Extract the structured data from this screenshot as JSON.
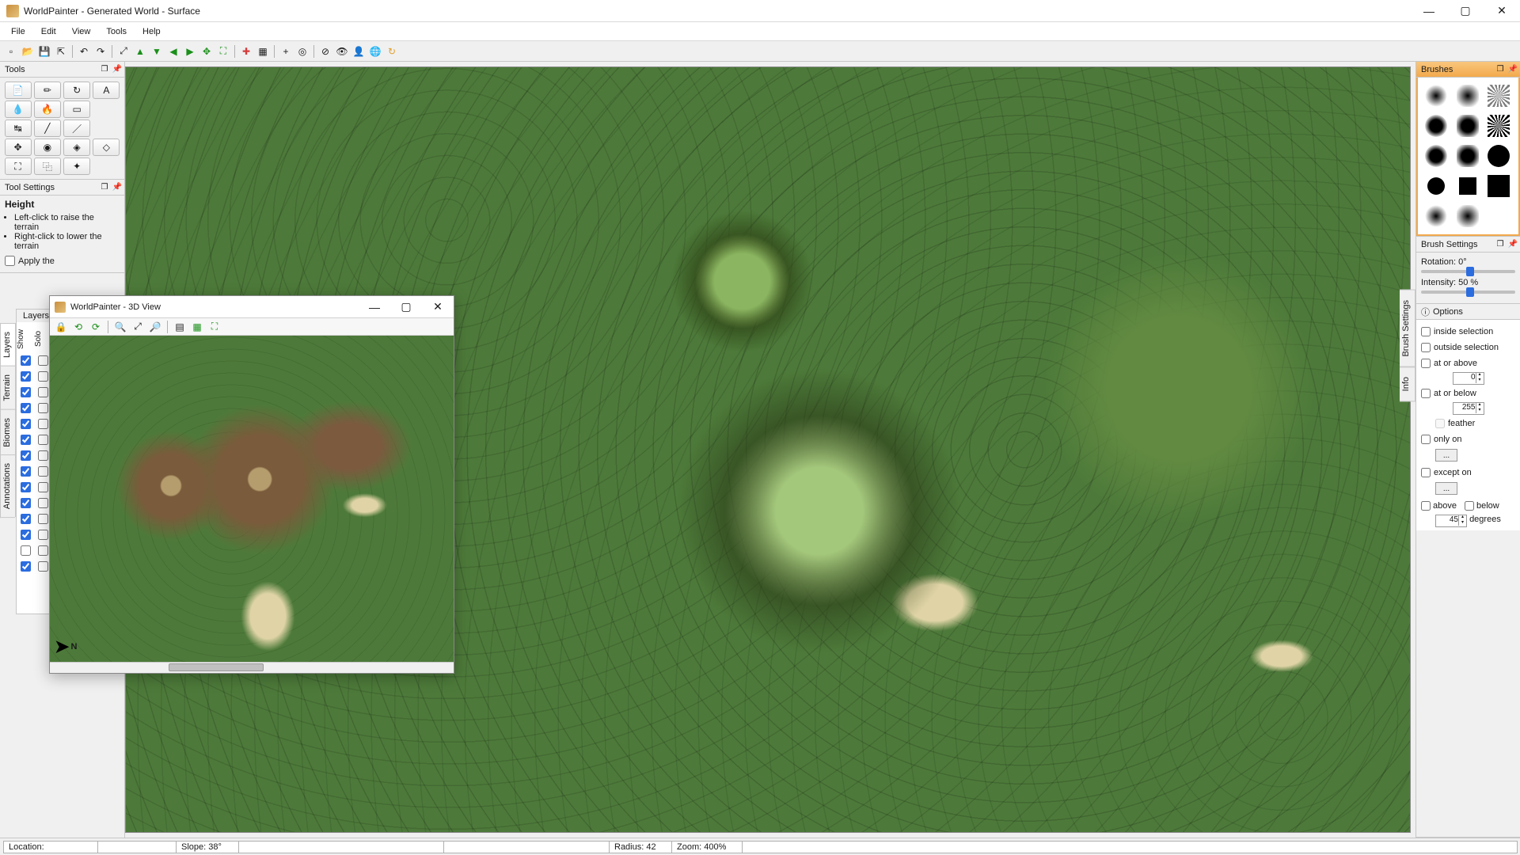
{
  "window": {
    "title": "WorldPainter - Generated World - Surface"
  },
  "menus": [
    "File",
    "Edit",
    "View",
    "Tools",
    "Help"
  ],
  "main_toolbar_icons": [
    "new",
    "open",
    "save",
    "export",
    "sep",
    "undo",
    "redo",
    "sep",
    "zoom-reset",
    "zoom-fit",
    "sep",
    "center-up",
    "center-down",
    "center-left",
    "center-right",
    "move-all",
    "sep",
    "marker",
    "grid",
    "sep",
    "plus",
    "circle-target",
    "sep",
    "eye-off",
    "eye",
    "world",
    "globe2",
    "refresh"
  ],
  "tools_panel": {
    "title": "Tools",
    "tools": [
      {
        "name": "import-tool",
        "glyph": "📄"
      },
      {
        "name": "pencil-tool",
        "glyph": "✏"
      },
      {
        "name": "rotate-tool",
        "glyph": "↻"
      },
      {
        "name": "text-tool",
        "glyph": "A"
      },
      {
        "name": "drop-tool",
        "glyph": "💧"
      },
      {
        "name": "flame-tool",
        "glyph": "🔥"
      },
      {
        "name": "rect-tool",
        "glyph": "▭"
      },
      {
        "name": "blank1",
        "glyph": ""
      },
      {
        "name": "swap-tool",
        "glyph": "↹"
      },
      {
        "name": "line-tool",
        "glyph": "╱"
      },
      {
        "name": "line2-tool",
        "glyph": "／"
      },
      {
        "name": "blank2",
        "glyph": ""
      },
      {
        "name": "move-tool",
        "glyph": "✥"
      },
      {
        "name": "sphere-tool",
        "glyph": "◉"
      },
      {
        "name": "eye-tool",
        "glyph": "◈"
      },
      {
        "name": "eye2-tool",
        "glyph": "◇"
      },
      {
        "name": "select-tool",
        "glyph": "⛶"
      },
      {
        "name": "copy-tool",
        "glyph": "⿻"
      },
      {
        "name": "sparkle-tool",
        "glyph": "✦"
      },
      {
        "name": "blank3",
        "glyph": ""
      }
    ]
  },
  "tool_settings": {
    "title": "Tool Settings",
    "heading": "Height",
    "bullets": [
      "Left-click to raise the terrain",
      "Right-click to lower the terrain"
    ],
    "apply_theme_label": "Apply the"
  },
  "side_tabs_left": [
    "Layers",
    "Terrain",
    "Biomes",
    "Annotations"
  ],
  "layers": {
    "title": "Layers",
    "col_headers": [
      "Show",
      "Solo"
    ],
    "rows": 14
  },
  "float_window": {
    "title": "WorldPainter - 3D View",
    "toolbar_icons": [
      "lock",
      "rotate-ccw",
      "rotate-cw",
      "sep",
      "zoom-out",
      "zoom-reset",
      "zoom-in",
      "sep",
      "layers",
      "grid",
      "expand"
    ],
    "compass": "N"
  },
  "right": {
    "brushes_title": "Brushes",
    "brush_settings_title": "Brush Settings",
    "rotation_label": "Rotation:",
    "rotation_value": "0°",
    "intensity_label": "Intensity:",
    "intensity_value": "50 %",
    "options_title": "Options",
    "opt_inside": "inside selection",
    "opt_outside": "outside selection",
    "opt_at_above": "at or above",
    "opt_at_above_val": "0",
    "opt_at_below": "at or below",
    "opt_at_below_val": "255",
    "opt_feather": "feather",
    "opt_only_on": "only on",
    "opt_except_on": "except on",
    "opt_above": "above",
    "opt_below": "below",
    "opt_degrees": "degrees",
    "opt_degrees_val": "45",
    "dots": "..."
  },
  "side_tabs_right": [
    "Brush Settings",
    "Info"
  ],
  "statusbar": {
    "location_label": "Location:",
    "slope": "Slope: 38°",
    "radius": "Radius: 42",
    "zoom": "Zoom: 400%"
  }
}
